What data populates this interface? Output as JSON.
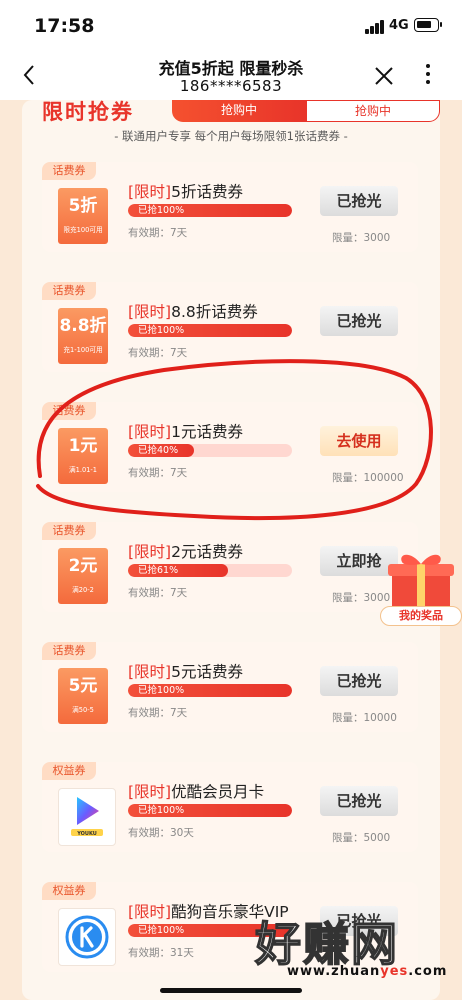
{
  "status_bar": {
    "time": "17:58",
    "network": "4G"
  },
  "nav": {
    "title": "充值5折起 限量秒杀",
    "subtitle": "186****6583"
  },
  "banner": {
    "title": "限时抢券",
    "tab_active": "抢购中",
    "tab_inactive": "抢购中",
    "tagline": "- 联通用户专享 每个用户每场限领1张话费券 -"
  },
  "cards": [
    {
      "tag": "话费券",
      "kind": "coupon",
      "coupon_main": "5折",
      "coupon_sub": "限充100可用",
      "title_prefix": "[限时]",
      "title_name": "5折话费券",
      "progress_text": "已抢100%",
      "progress": 100,
      "validity": "有效期：7天",
      "action": "已抢光",
      "action_type": "soldout",
      "limit": "限量：3000"
    },
    {
      "tag": "话费券",
      "kind": "coupon",
      "coupon_main": "8.8折",
      "coupon_sub": "充1-100可用",
      "title_prefix": "[限时]",
      "title_name": "8.8折话费券",
      "progress_text": "已抢100%",
      "progress": 100,
      "validity": "有效期：7天",
      "action": "已抢光",
      "action_type": "soldout",
      "limit": ""
    },
    {
      "tag": "话费券",
      "kind": "coupon",
      "coupon_main": "1元",
      "coupon_sub": "满1.01-1",
      "title_prefix": "[限时]",
      "title_name": "1元话费券",
      "progress_text": "已抢40%",
      "progress": 40,
      "validity": "有效期：7天",
      "action": "去使用",
      "action_type": "use",
      "limit": "限量：100000"
    },
    {
      "tag": "话费券",
      "kind": "coupon",
      "coupon_main": "2元",
      "coupon_sub": "满20-2",
      "title_prefix": "[限时]",
      "title_name": "2元话费券",
      "progress_text": "已抢61%",
      "progress": 61,
      "validity": "有效期：7天",
      "action": "立即抢",
      "action_type": "grab",
      "limit": "限量：3000"
    },
    {
      "tag": "话费券",
      "kind": "coupon",
      "coupon_main": "5元",
      "coupon_sub": "满50-5",
      "title_prefix": "[限时]",
      "title_name": "5元话费券",
      "progress_text": "已抢100%",
      "progress": 100,
      "validity": "有效期：7天",
      "action": "已抢光",
      "action_type": "soldout",
      "limit": "限量：10000"
    },
    {
      "tag": "权益券",
      "kind": "youku",
      "title_prefix": "[限时]",
      "title_name": "优酷会员月卡",
      "progress_text": "已抢100%",
      "progress": 100,
      "validity": "有效期：30天",
      "action": "已抢光",
      "action_type": "soldout",
      "limit": "限量：5000"
    },
    {
      "tag": "权益券",
      "kind": "kugou",
      "title_prefix": "[限时]",
      "title_name": "酷狗音乐豪华VIP",
      "progress_text": "已抢100%",
      "progress": 100,
      "validity": "有效期：31天",
      "action": "已抢光",
      "action_type": "soldout",
      "limit": ""
    }
  ],
  "youku_logo_text": "YOUKU",
  "gift": {
    "label": "我的奖品"
  },
  "watermark": {
    "main": "好赚网",
    "url_pre": "www.zhuan",
    "url_hl": "yes",
    "url_post": ".com"
  },
  "colors": {
    "accent": "#e8342a",
    "page_bg": "#fbe9d7",
    "annotation": "#e0201a"
  }
}
